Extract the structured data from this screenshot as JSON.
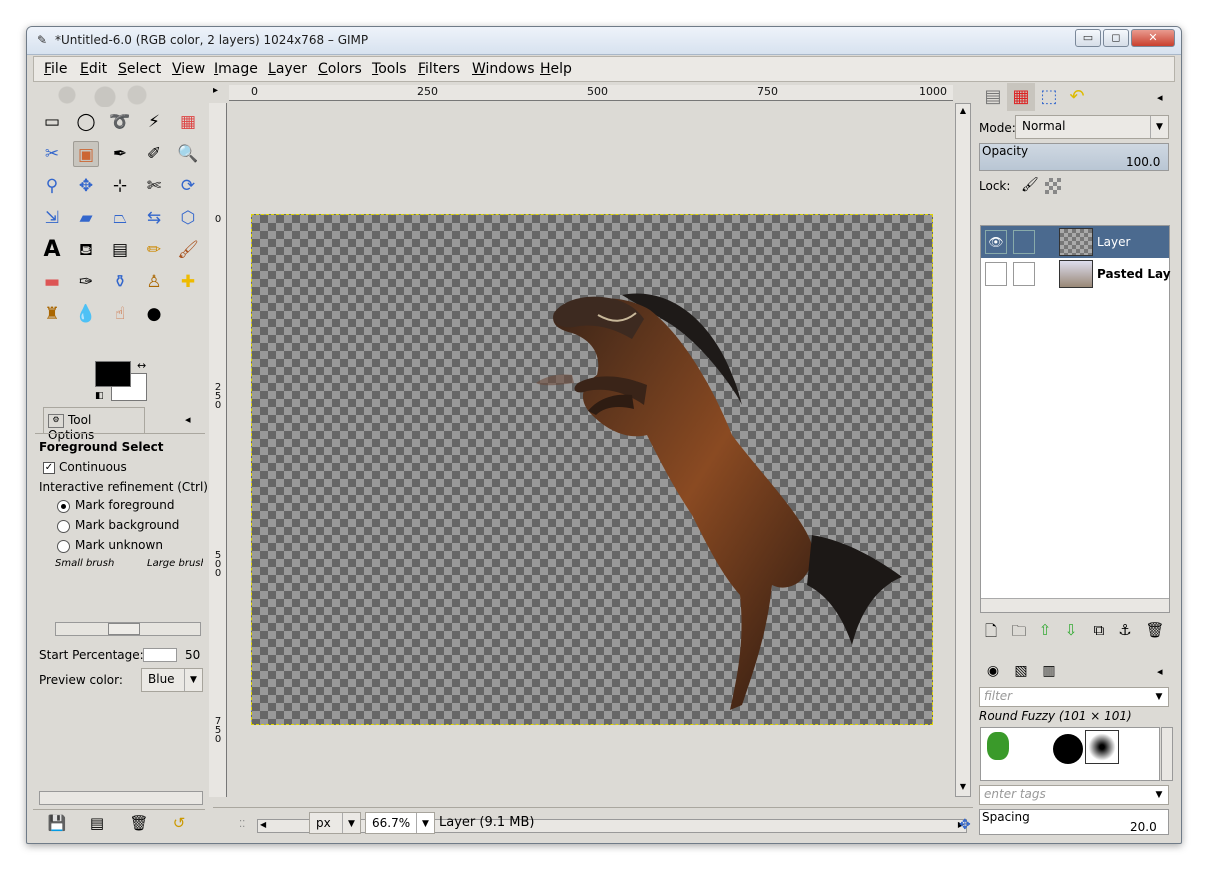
{
  "window": {
    "title": "*Untitled-6.0 (RGB color, 2 layers) 1024x768 – GIMP",
    "controls": {
      "minimize": "▭",
      "maximize": "◻",
      "close": "✕"
    }
  },
  "menu": [
    "File",
    "Edit",
    "Select",
    "View",
    "Image",
    "Layer",
    "Colors",
    "Tools",
    "Filters",
    "Windows",
    "Help"
  ],
  "toolbox": {
    "tools": [
      "rect-select-icon",
      "ellipse-select-icon",
      "free-select-icon",
      "fuzzy-select-icon",
      "color-select-icon",
      "scissors-icon",
      "foreground-select-icon",
      "paths-icon",
      "color-picker-icon",
      "zoom-icon",
      "measure-icon",
      "move-icon",
      "align-icon",
      "crop-icon",
      "rotate-icon",
      "scale-icon",
      "shear-icon",
      "perspective-icon",
      "flip-icon",
      "cage-icon",
      "text-icon",
      "bucket-fill-icon",
      "blend-icon",
      "pencil-icon",
      "paintbrush-icon",
      "eraser-icon",
      "airbrush-icon",
      "ink-icon",
      "clone-icon",
      "heal-icon",
      "perspective-clone-icon",
      "blur-icon",
      "smudge-icon",
      "dodge-burn-icon"
    ],
    "fg_color": "#000000",
    "bg_color": "#ffffff"
  },
  "tool_options": {
    "tab_label": "Tool Options",
    "title": "Foreground Select",
    "continuous": "Continuous",
    "refinement": "Interactive refinement  (Ctrl)",
    "mark_foreground": "Mark foreground",
    "mark_background": "Mark background",
    "mark_unknown": "Mark unknown",
    "small_brush": "Small brush",
    "large_brush": "Large brush",
    "start_percentage_label": "Start Percentage:",
    "start_percentage_value": "50",
    "preview_color_label": "Preview color:",
    "preview_color_value": "Blue"
  },
  "rulers": {
    "h_labels": [
      "0",
      "250",
      "500",
      "750",
      "1000"
    ],
    "v_labels": [
      "0",
      "250",
      "500",
      "750"
    ]
  },
  "status": {
    "unit": "px",
    "zoom": "66.7%",
    "layer_info": "Layer (9.1 MB)"
  },
  "layers_panel": {
    "mode_label": "Mode:",
    "mode_value": "Normal",
    "opacity_label": "Opacity",
    "opacity_value": "100.0",
    "lock_label": "Lock:",
    "layers": [
      {
        "name": "Layer",
        "selected": true,
        "visible": true
      },
      {
        "name": "Pasted Layer",
        "selected": false,
        "visible": false
      }
    ]
  },
  "brushes_panel": {
    "filter_placeholder": "filter",
    "brush_name": "Round Fuzzy (101 × 101)",
    "tags_placeholder": "enter tags",
    "spacing_label": "Spacing",
    "spacing_value": "20.0"
  },
  "colors": {
    "selection_bg": "#4b6a8f",
    "checker_dark": "#666666",
    "checker_light": "#999999",
    "ui_bg": "#dcdad5"
  }
}
